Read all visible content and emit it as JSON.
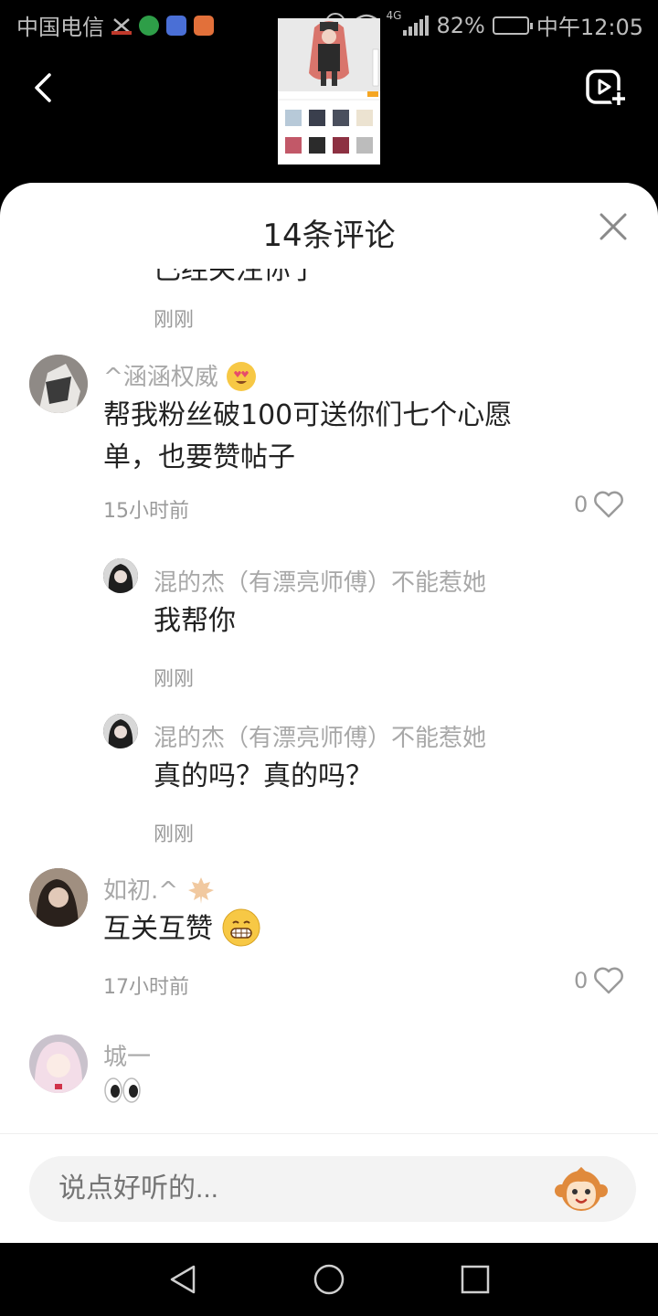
{
  "status_bar": {
    "carrier": "中国电信",
    "network": "4G",
    "battery": "82%",
    "time": "中午12:05"
  },
  "sheet": {
    "title": "14条评论",
    "partial_top": {
      "text": "已经关注你了",
      "time": "刚刚"
    }
  },
  "comments": [
    {
      "user": "^涵涵权威",
      "text_line1": "帮我粉丝破100可送你们七个心愿",
      "text_line2": "单，也要赞帖子",
      "time": "15小时前",
      "likes": "0",
      "replies": [
        {
          "user": "混的杰（有漂亮师傅）不能惹她",
          "text": "我帮你",
          "time": "刚刚"
        },
        {
          "user": "混的杰（有漂亮师傅）不能惹她",
          "text": "真的吗？真的吗？",
          "time": "刚刚"
        }
      ]
    },
    {
      "user": "如初.^",
      "text": "互关互赞",
      "time": "17小时前",
      "likes": "0"
    },
    {
      "user": "城一",
      "text": ""
    }
  ],
  "input": {
    "placeholder": "说点好听的..."
  },
  "icons": {
    "back": "chevron-left-icon",
    "post": "video-add-icon",
    "close": "close-icon",
    "like": "heart-outline-icon",
    "emoji": "monkey-emoji-icon"
  }
}
